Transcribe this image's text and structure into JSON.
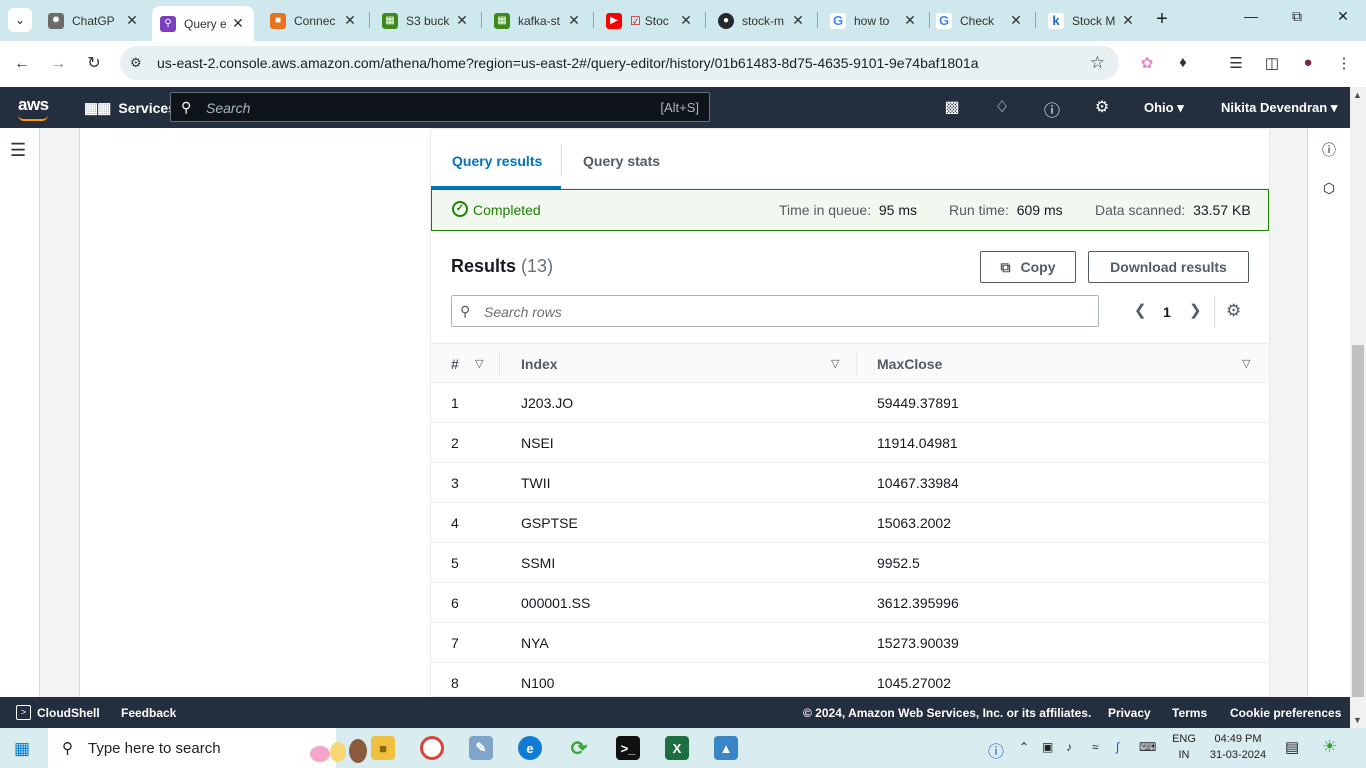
{
  "browser": {
    "tabs": [
      {
        "title": "ChatGP",
        "favicon_color": "#6b6b6b",
        "active": false
      },
      {
        "title": "Query e",
        "favicon_color": "#7b3fbf",
        "active": true
      },
      {
        "title": "Connec",
        "favicon_color": "#e8731f",
        "active": false
      },
      {
        "title": "S3 buck",
        "favicon_color": "#3c8a1a",
        "active": false
      },
      {
        "title": "kafka-st",
        "favicon_color": "#3c8a1a",
        "active": false
      },
      {
        "title": "Stoc",
        "favicon_color": "#ff0000",
        "active": false
      },
      {
        "title": "stock-m",
        "favicon_color": "#24292f",
        "active": false
      },
      {
        "title": "how to",
        "favicon_color": "#4285f4",
        "active": false
      },
      {
        "title": "Check",
        "favicon_color": "#4285f4",
        "active": false
      },
      {
        "title": "Stock M",
        "favicon_color": "#1e66d0",
        "active": false
      }
    ],
    "url": "us-east-2.console.aws.amazon.com/athena/home?region=us-east-2#/query-editor/history/01b61483-8d75-4635-9101-9e74baf1801a"
  },
  "aws_nav": {
    "logo": "aws",
    "services_label": "Services",
    "search_placeholder": "Search",
    "search_shortcut": "[Alt+S]",
    "region": "Ohio",
    "user": "Nikita Devendran"
  },
  "results_panel": {
    "tabs": [
      "Query results",
      "Query stats"
    ],
    "status": "Completed",
    "time_in_queue_label": "Time in queue:",
    "time_in_queue": "95 ms",
    "run_time_label": "Run time:",
    "run_time": "609 ms",
    "data_scanned_label": "Data scanned:",
    "data_scanned": "33.57 KB",
    "results_title": "Results",
    "results_count": "(13)",
    "copy_label": "Copy",
    "download_label": "Download results",
    "search_placeholder": "Search rows",
    "page_number": "1",
    "columns": [
      "#",
      "Index",
      "MaxClose"
    ],
    "rows": [
      [
        "1",
        "J203.JO",
        "59449.37891"
      ],
      [
        "2",
        "NSEI",
        "11914.04981"
      ],
      [
        "3",
        "TWII",
        "10467.33984"
      ],
      [
        "4",
        "GSPTSE",
        "15063.2002"
      ],
      [
        "5",
        "SSMI",
        "9952.5"
      ],
      [
        "6",
        "000001.SS",
        "3612.395996"
      ],
      [
        "7",
        "NYA",
        "15273.90039"
      ],
      [
        "8",
        "N100",
        "1045.27002"
      ]
    ]
  },
  "footer": {
    "cloudshell": "CloudShell",
    "feedback": "Feedback",
    "copyright": "© 2024, Amazon Web Services, Inc. or its affiliates.",
    "privacy": "Privacy",
    "terms": "Terms",
    "cookie": "Cookie preferences"
  },
  "taskbar": {
    "search_placeholder": "Type here to search",
    "lang_top": "ENG",
    "lang_bottom": "IN",
    "time": "04:49 PM",
    "date": "31-03-2024"
  },
  "colors": {
    "aws_nav": "#232f3e",
    "link_blue": "#0073bb",
    "success_green": "#1d8102"
  }
}
